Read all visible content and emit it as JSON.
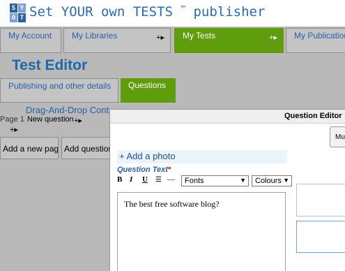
{
  "header": {
    "logo_letters": [
      "S",
      "Y",
      "O",
      "T"
    ],
    "brand": "Set YOUR own TESTS",
    "brand_tm": "™",
    "brand_suffix": "publisher"
  },
  "nav": {
    "tabs": [
      {
        "label": "My Account"
      },
      {
        "label": "My Libraries",
        "plus": "+▸"
      },
      {
        "label": "My Tests",
        "plus": "+▸",
        "active": true
      },
      {
        "label": "My Publication"
      }
    ]
  },
  "page_title": "Test Editor",
  "subtabs": {
    "details": "Publishing and other details",
    "questions": "Questions"
  },
  "test_name": "Drag-And-Drop Cont",
  "page_list": {
    "page_label": "Page 1",
    "new_question": "New question",
    "question_plus": "+▸",
    "page_plus": "+▸"
  },
  "buttons": {
    "add_page": "Add a new page",
    "add_question": "Add question"
  },
  "dialog": {
    "title": "Question Editor",
    "edge_button": "Mu",
    "add_photo": "+ Add a photo",
    "question_text_label": "Question Text",
    "required_mark": "*",
    "toolbar": {
      "bold": "B",
      "italic": "I",
      "underline": "U",
      "list": "☰",
      "rule": "—"
    },
    "fonts_select": "Fonts",
    "colours_select": "Colours",
    "select_arrow": "▼",
    "question_text_value": "The best free software blog?"
  }
}
